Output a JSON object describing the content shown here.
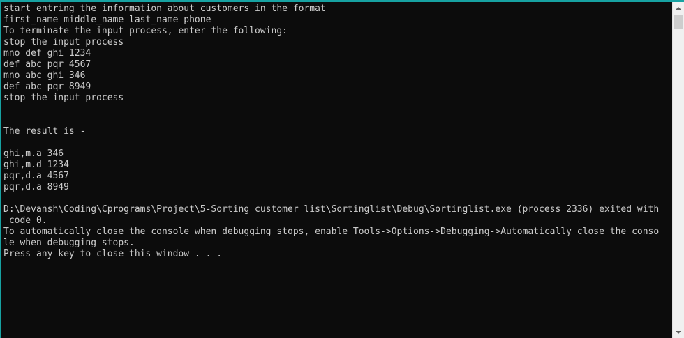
{
  "console": {
    "lines": [
      "start entring the information about customers in the format",
      "first_name middle_name last_name phone",
      "To terminate the input process, enter the following:",
      "stop the input process",
      "mno def ghi 1234",
      "def abc pqr 4567",
      "mno abc ghi 346",
      "def abc pqr 8949",
      "stop the input process",
      "",
      "",
      "The result is -",
      "",
      "ghi,m.a 346",
      "ghi,m.d 1234",
      "pqr,d.a 4567",
      "pqr,d.a 8949",
      "",
      "D:\\Devansh\\Coding\\Cprograms\\Project\\5-Sorting customer list\\Sortinglist\\Debug\\Sortinglist.exe (process 2336) exited with",
      " code 0.",
      "To automatically close the console when debugging stops, enable Tools->Options->Debugging->Automatically close the conso",
      "le when debugging stops.",
      "Press any key to close this window . . ."
    ]
  },
  "colors": {
    "background": "#0c0c0c",
    "text": "#cccccc",
    "accent_border": "#17a2a2",
    "scrollbar": "#f0f0f0"
  },
  "icons": {
    "scroll_up": "chevron-up-icon",
    "scroll_down": "chevron-down-icon"
  }
}
